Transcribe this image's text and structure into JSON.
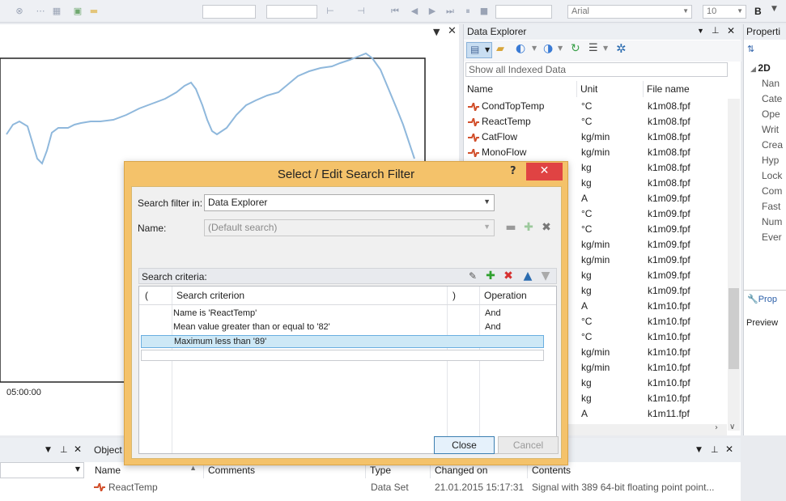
{
  "toolbar": {
    "font_name": "Arial",
    "font_size": "10",
    "bold_label": "B"
  },
  "chart_panel": {
    "time_label": "05:00:00"
  },
  "data_explorer": {
    "title": "Data Explorer",
    "filter_text": "Show all Indexed Data",
    "columns": [
      "Name",
      "Unit",
      "File name"
    ],
    "rows": [
      {
        "name": "CondTopTemp",
        "unit": "°C",
        "file": "k1m08.fpf"
      },
      {
        "name": "ReactTemp",
        "unit": "°C",
        "file": "k1m08.fpf"
      },
      {
        "name": "CatFlow",
        "unit": "kg/min",
        "file": "k1m08.fpf"
      },
      {
        "name": "MonoFlow",
        "unit": "kg/min",
        "file": "k1m08.fpf"
      },
      {
        "name": "",
        "unit": "kg",
        "file": "k1m08.fpf"
      },
      {
        "name": "",
        "unit": "kg",
        "file": "k1m08.fpf"
      },
      {
        "name": "",
        "unit": "A",
        "file": "k1m09.fpf"
      },
      {
        "name": "",
        "unit": "°C",
        "file": "k1m09.fpf"
      },
      {
        "name": "",
        "unit": "°C",
        "file": "k1m09.fpf"
      },
      {
        "name": "",
        "unit": "kg/min",
        "file": "k1m09.fpf"
      },
      {
        "name": "",
        "unit": "kg/min",
        "file": "k1m09.fpf"
      },
      {
        "name": "",
        "unit": "kg",
        "file": "k1m09.fpf"
      },
      {
        "name": "",
        "unit": "kg",
        "file": "k1m09.fpf"
      },
      {
        "name": "",
        "unit": "A",
        "file": "k1m10.fpf"
      },
      {
        "name": "",
        "unit": "°C",
        "file": "k1m10.fpf"
      },
      {
        "name": "",
        "unit": "°C",
        "file": "k1m10.fpf"
      },
      {
        "name": "",
        "unit": "kg/min",
        "file": "k1m10.fpf"
      },
      {
        "name": "",
        "unit": "kg/min",
        "file": "k1m10.fpf"
      },
      {
        "name": "",
        "unit": "kg",
        "file": "k1m10.fpf"
      },
      {
        "name": "",
        "unit": "kg",
        "file": "k1m10.fpf"
      },
      {
        "name": "",
        "unit": "A",
        "file": "k1m11.fpf"
      }
    ]
  },
  "properties": {
    "title": "Properti",
    "section": "2D",
    "items": [
      "Nan",
      "Cate",
      "Ope",
      "Writ",
      "Crea",
      "Hyp",
      "Lock",
      "Com",
      "Fast",
      "Num",
      "Ever"
    ],
    "tab_label": "Prop",
    "preview_label": "Preview"
  },
  "bottom_panel": {
    "title": "Object",
    "columns": [
      "Name",
      "Comments",
      "Type",
      "Changed on",
      "Contents"
    ],
    "row": {
      "name": "ReactTemp",
      "comments": "",
      "type": "Data Set",
      "changed": "21.01.2015 15:17:31",
      "contents": "Signal with 389 64-bit floating point point..."
    }
  },
  "dialog": {
    "title": "Select / Edit Search Filter",
    "help": "?",
    "close_glyph": "✕",
    "filter_in_label": "Search filter in:",
    "filter_in_value": "Data Explorer",
    "name_label": "Name:",
    "name_value": "(Default search)",
    "criteria_label": "Search criteria:",
    "grid_columns": [
      "(",
      "Search criterion",
      ")",
      "Operation"
    ],
    "criteria": [
      {
        "criterion": "Name is 'ReactTemp'",
        "operation": "And"
      },
      {
        "criterion": "Mean value greater than or equal to '82'",
        "operation": "And"
      },
      {
        "criterion": "Maximum less than '89'",
        "operation": ""
      }
    ],
    "close_button": "Close",
    "cancel_button": "Cancel"
  },
  "colors": {
    "dialog_frame": "#f4c26a",
    "close_red": "#e04343",
    "selection": "#cde8f6",
    "chart_line": "#8fb8dc",
    "signal_icon": "#d2502c"
  }
}
